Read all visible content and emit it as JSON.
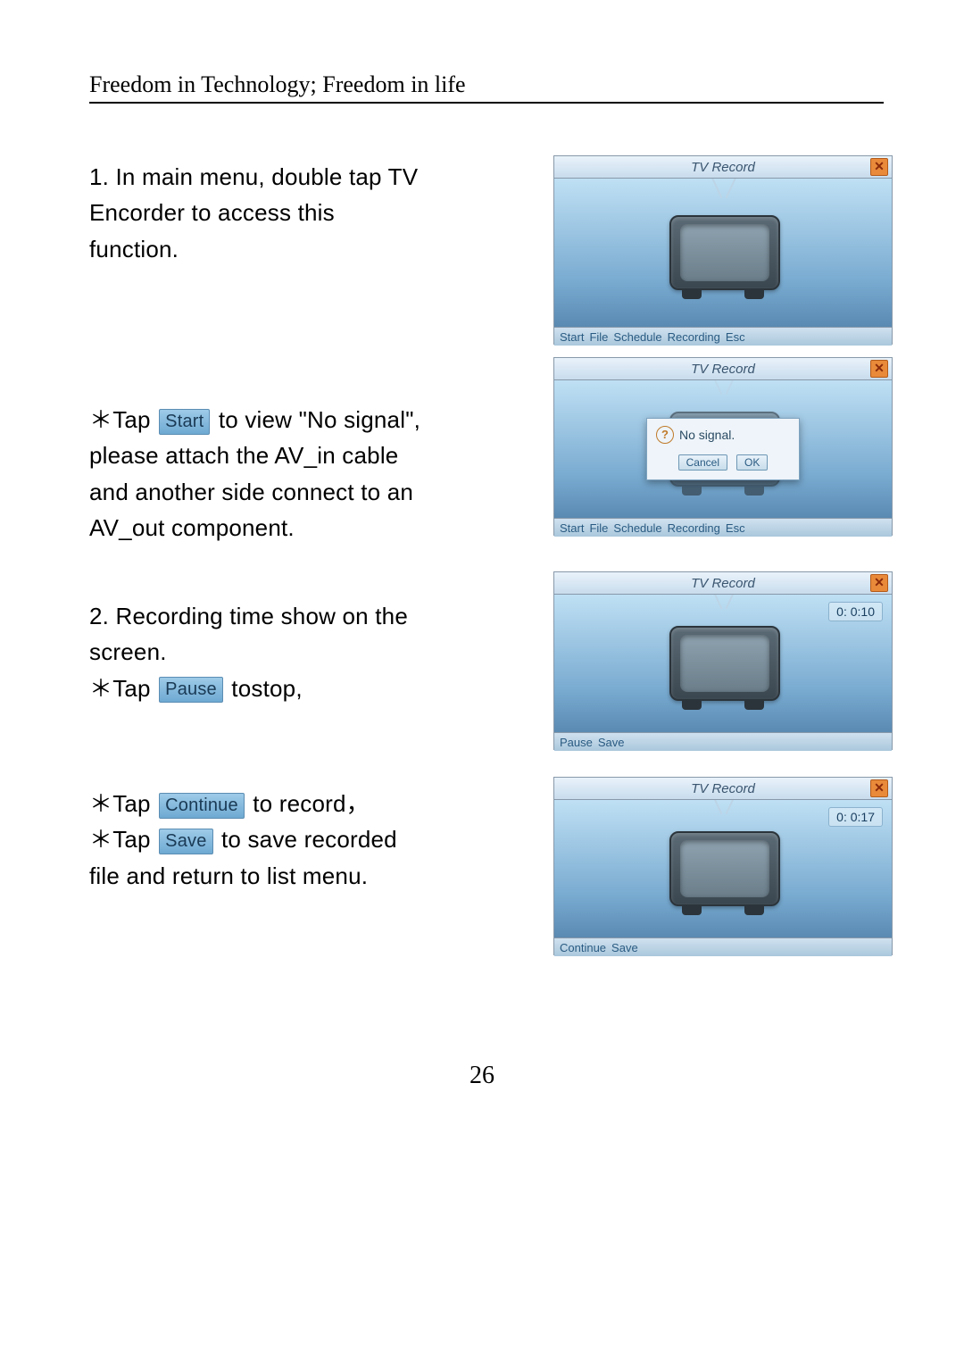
{
  "header": "Freedom in Technology; Freedom in life",
  "page_number": "26",
  "step1": {
    "text": "1. In main menu, double tap TV Encorder to access this function."
  },
  "step2": {
    "prefix": "＊Tap ",
    "pill": "Start",
    "after": " to view \"No signal\", please attach the AV_in cable and another side connect to an AV_out component."
  },
  "step3": {
    "line1": "2. Recording time show on the screen.",
    "prefix": "＊Tap ",
    "pill": "Pause",
    "after": " tostop,"
  },
  "step4": {
    "l1_prefix": "＊Tap ",
    "l1_pill": "Continue",
    "l1_after": " to record，",
    "l2_prefix": "＊Tap ",
    "l2_pill": "Save",
    "l2_after": " to save recorded file and return to list menu."
  },
  "shots": {
    "title": "TV Record",
    "close": "✕",
    "footer_full": [
      "Start",
      "File",
      "Schedule",
      "Recording",
      "Esc"
    ],
    "footer_rec": [
      "Pause",
      "Save"
    ],
    "footer_cont": [
      "Continue",
      "Save"
    ],
    "timer3": "0: 0:10",
    "timer4": "0: 0:17",
    "dialog": {
      "msg": "No signal.",
      "cancel": "Cancel",
      "ok": "OK"
    }
  }
}
